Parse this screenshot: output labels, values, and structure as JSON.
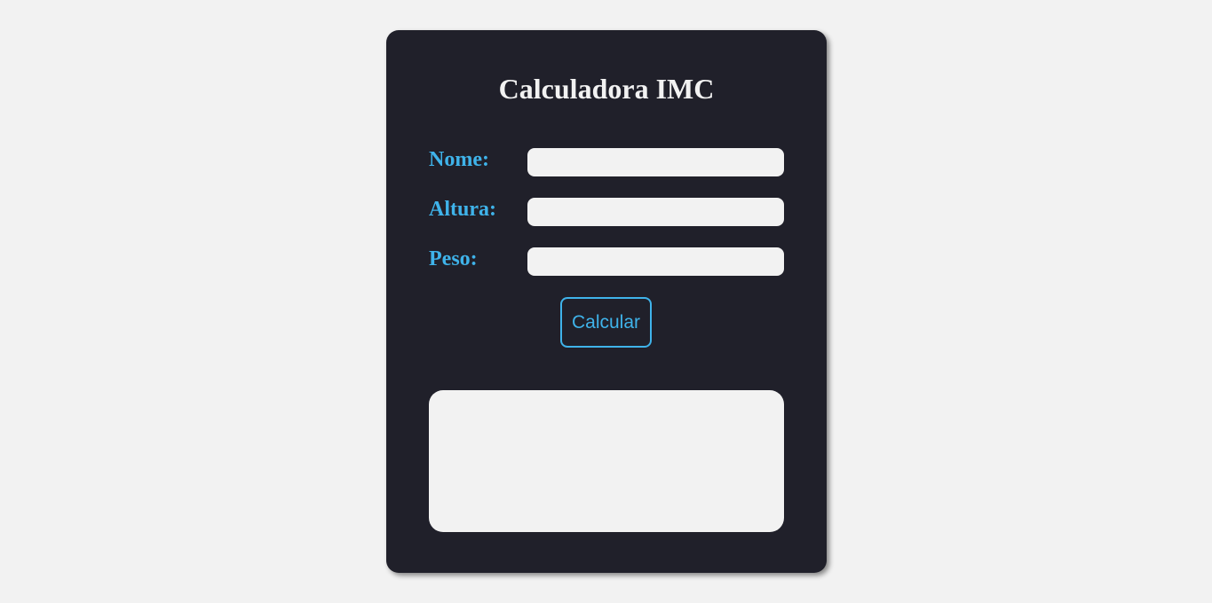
{
  "form": {
    "title": "Calculadora IMC",
    "fields": [
      {
        "label": "Nome:",
        "value": "",
        "placeholder": ""
      },
      {
        "label": "Altura:",
        "value": "",
        "placeholder": ""
      },
      {
        "label": "Peso:",
        "value": "",
        "placeholder": ""
      }
    ],
    "submit_label": "Calcular",
    "result_text": ""
  },
  "colors": {
    "page_background": "#f2f2f2",
    "card_background": "#20202a",
    "accent": "#3fb3ea",
    "title": "#f2f2f2",
    "input_background": "#f2f2f2"
  }
}
